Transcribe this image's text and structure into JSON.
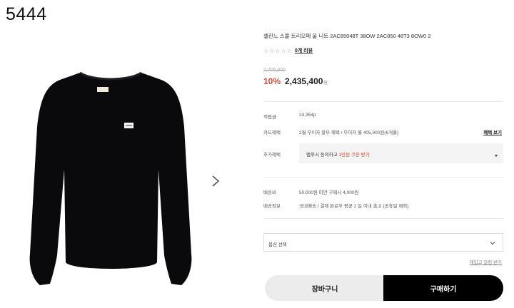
{
  "image_label": "5444",
  "icons": {
    "next": "chevron-right-icon",
    "rating": "star-icon",
    "dropdown": "chevron-down-icon"
  },
  "colors": {
    "accent": "#e24b3b",
    "buy_button": "#000000",
    "cart_button": "#ececec",
    "sweater": "#0a0a0c"
  },
  "product": {
    "name": "셀린느 스몰 트리오페 울 니트 2AC85048T 38OW 2AC850 48T3 8OW0 2",
    "rating_stars": "☆☆☆☆☆",
    "review_link": "0개 리뷰",
    "original_price": "2,706,000",
    "discount": "10%",
    "sale_price": "2,435,400",
    "currency": "원"
  },
  "info": {
    "points_label": "적립금",
    "points_value": "24,354p",
    "card_label": "카드혜택",
    "card_value": "2월 무이자 할부 혜택 / 무이자 월 405,900원(6개월)",
    "card_link": "혜택 보기",
    "extra_label": "추가혜택",
    "extra_text": "앱푸시 동의하고 ",
    "extra_highlight": "1만원 쿠폰 받기",
    "shipping_fee_label": "배송비",
    "shipping_fee_value": "50,000원 미만 구매시 4,000원",
    "shipping_info_label": "배송정보",
    "shipping_info_value": "국내배송 / 결제 완료후 평균 2 일 이내 출고 (공휴일 제외)"
  },
  "option": {
    "placeholder": "옵션 선택"
  },
  "restock_link": "재입고 알림 받기",
  "buttons": {
    "cart": "장바구니",
    "buy": "구매하기"
  }
}
